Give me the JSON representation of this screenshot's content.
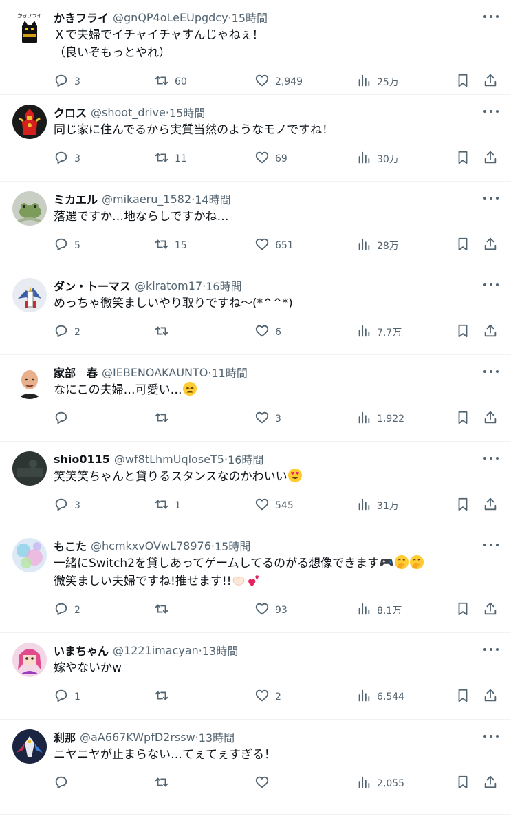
{
  "posts": [
    {
      "name": "かきフライ",
      "handle": "@gnQP4oLeEUpgdcy",
      "time": "15時間",
      "text": "Ｘで夫婦でイチャイチャすんじゃねぇ！\n（良いぞもっとやれ）",
      "replies": "3",
      "retweets": "60",
      "likes": "2,949",
      "views": "25万",
      "avatar": "cat",
      "avatar_label": "かきフライ",
      "emojis": []
    },
    {
      "name": "クロス",
      "handle": "@shoot_drive",
      "time": "15時間",
      "text": "同じ家に住んでるから実質当然のようなモノですね！",
      "replies": "3",
      "retweets": "11",
      "likes": "69",
      "views": "30万",
      "avatar": "hero",
      "emojis": []
    },
    {
      "name": "ミカエル",
      "handle": "@mikaeru_1582",
      "time": "14時間",
      "text": "落選ですか…地ならしですかね…",
      "replies": "5",
      "retweets": "15",
      "likes": "651",
      "views": "28万",
      "avatar": "frog",
      "emojis": []
    },
    {
      "name": "ダン・トーマス",
      "handle": "@kiratom17",
      "time": "16時間",
      "text": "めっちゃ微笑ましいやり取りですね～(*^^*)",
      "replies": "2",
      "retweets": "",
      "likes": "6",
      "views": "7.7万",
      "avatar": "robot",
      "emojis": []
    },
    {
      "name": "家部　春",
      "handle": "@IEBENOAKAUNTO",
      "time": "11時間",
      "text": "なにこの夫婦…可愛い…",
      "replies": "",
      "retweets": "",
      "likes": "3",
      "views": "1,922",
      "avatar": "bald",
      "emojis": [
        "tired-face-emoji"
      ]
    },
    {
      "name": "shio0115",
      "handle": "@wf8tLhmUqloseT5",
      "time": "16時間",
      "text": "笑笑笑ちゃんと貸りるスタンスなのかわいい",
      "replies": "3",
      "retweets": "1",
      "likes": "545",
      "views": "31万",
      "avatar": "dark",
      "emojis": [
        "heart-eyes-emoji"
      ]
    },
    {
      "name": "もこた",
      "handle": "@hcmkxvOVwL78976",
      "time": "15時間",
      "text": "一緒にSwitch2を貸しあってゲームしてるのがる想像できます",
      "text2": "微笑ましい夫婦ですね!推せます!!",
      "replies": "2",
      "retweets": "",
      "likes": "93",
      "views": "8.1万",
      "avatar": "bubbles",
      "emojis": [
        "gamepad-emoji",
        "hand-over-mouth-emoji",
        "hand-over-mouth-emoji"
      ],
      "emojis2": [
        "heart-hands-emoji",
        "two-hearts-emoji"
      ]
    },
    {
      "name": "いまちゃん",
      "handle": "@1221imacyan",
      "time": "13時間",
      "text": "嫁やないかw",
      "replies": "1",
      "retweets": "",
      "likes": "2",
      "views": "6,544",
      "avatar": "anime",
      "emojis": []
    },
    {
      "name": "刹那",
      "handle": "@aA667KWpfD2rssw",
      "time": "13時間",
      "text": "ニヤニヤが止まらない…てぇてぇすぎる！",
      "replies": "",
      "retweets": "",
      "likes": "",
      "views": "2,055",
      "avatar": "gundam",
      "emojis": []
    }
  ],
  "time_separator": " · ",
  "colors": {
    "text": "#0f1419",
    "secondary": "#536471",
    "border": "#eff3f4"
  }
}
